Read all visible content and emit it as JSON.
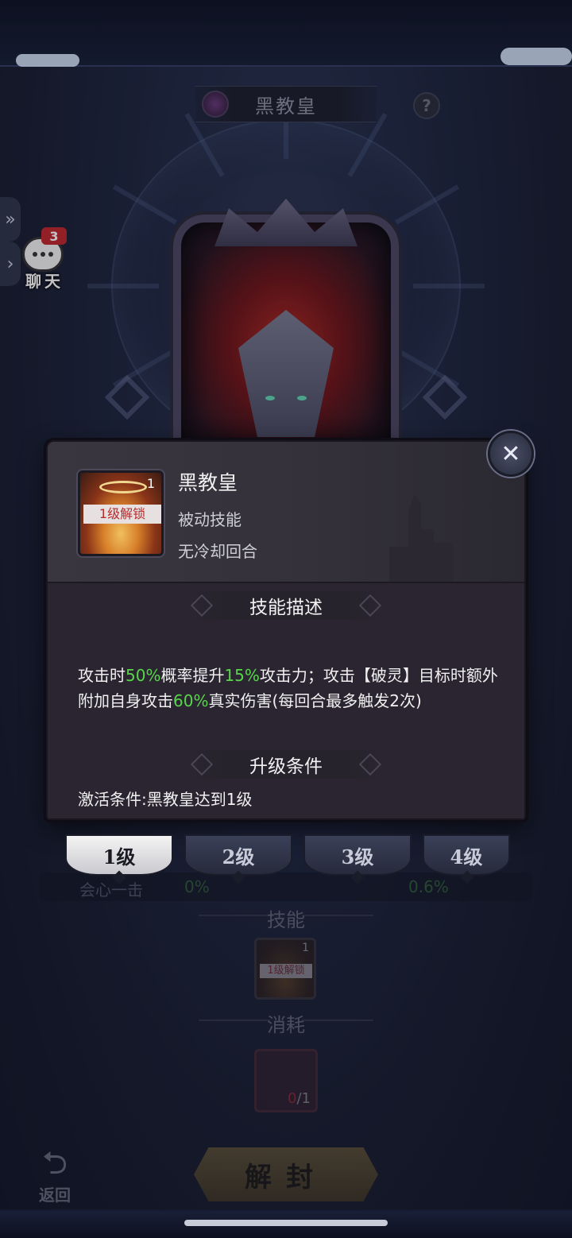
{
  "page": {
    "title": "黑教皇",
    "help_label": "?"
  },
  "chat": {
    "badge_count": "3",
    "label": "聊天"
  },
  "popup": {
    "skill_name": "黑教皇",
    "skill_type": "被动技能",
    "cooldown": "无冷却回合",
    "icon_tag": "1级解锁",
    "icon_level": "1",
    "desc_heading": "技能描述",
    "description_parts": [
      {
        "text": "攻击时",
        "highlight": false
      },
      {
        "text": "50%",
        "highlight": true
      },
      {
        "text": "概率提升",
        "highlight": false
      },
      {
        "text": "15%",
        "highlight": true
      },
      {
        "text": "攻击力；攻击【破灵】目标时额外附加自身攻击",
        "highlight": false
      },
      {
        "text": "60%",
        "highlight": true
      },
      {
        "text": "真实伤害(每回合最多触发2次)",
        "highlight": false
      }
    ],
    "upgrade_heading": "升级条件",
    "condition": "激活条件:黑教皇达到1级",
    "close_icon": "close-x-icon",
    "highlight_color": "#58d64a"
  },
  "level_tabs": [
    {
      "label": "1级",
      "active": true
    },
    {
      "label": "2级",
      "active": false
    },
    {
      "label": "3级",
      "active": false
    },
    {
      "label": "4级",
      "active": false
    }
  ],
  "background": {
    "stat_label": "会心一击",
    "stat_value_current": "0%",
    "stat_value_next": "0.6%",
    "skill_heading": "技能",
    "skill_icon_tag": "1级解锁",
    "skill_icon_level": "1",
    "consume_heading": "消耗",
    "consume_have": "0",
    "consume_need": "/1",
    "unseal_label": "解封",
    "back_label": "返回"
  }
}
